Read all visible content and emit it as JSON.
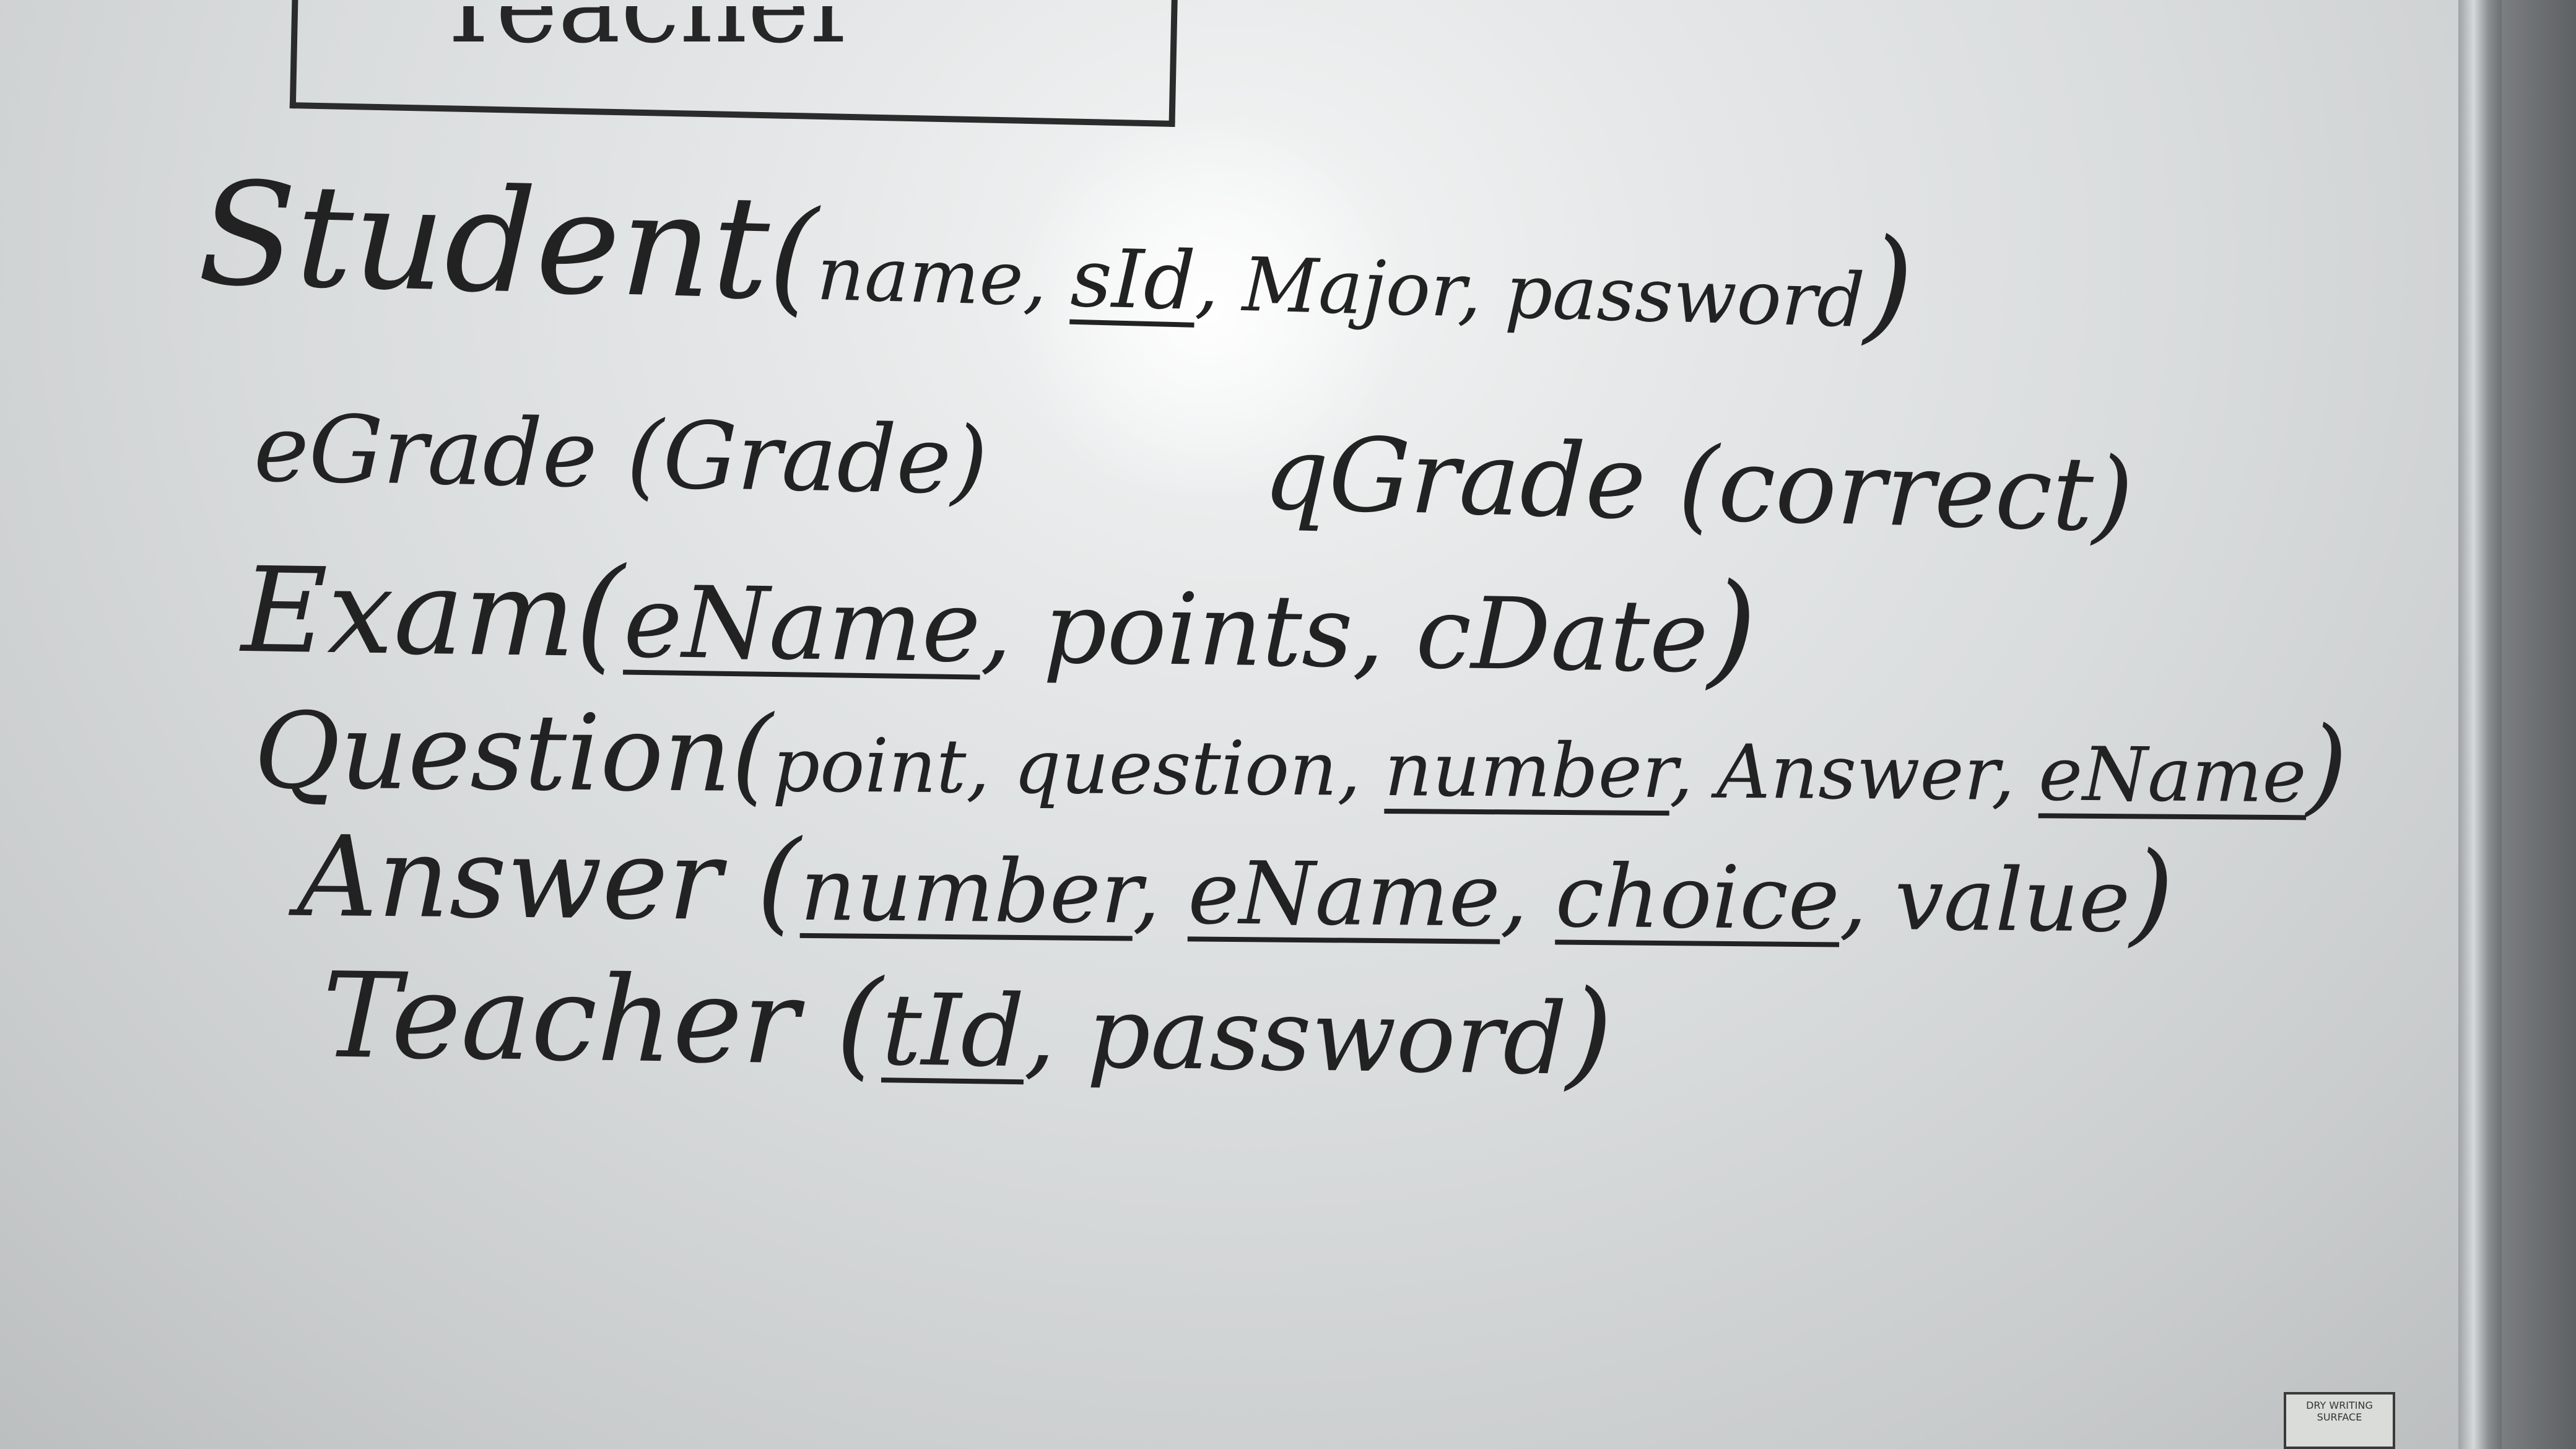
{
  "whiteboard": {
    "top_box_fragment": "Teacher",
    "lines": {
      "student": {
        "name": "Student",
        "open": "(",
        "f1": "name, ",
        "f2": "sId",
        "f3": ", Major, password",
        "close": ")"
      },
      "grades": {
        "egrade": "eGrade (Grade)",
        "qgrade": "qGrade (correct)"
      },
      "exam": {
        "name": "Exam",
        "open": "(",
        "f1": "eName",
        "f2": ", points, cDate",
        "close": ")"
      },
      "question": {
        "name": "Question",
        "open": "(",
        "f1": "point, question, ",
        "f2": "number",
        "f3": ", Answer, ",
        "f4": "eName",
        "close": ")"
      },
      "answer": {
        "name": "Answer",
        "open": " (",
        "f1": "number",
        "f2": ", ",
        "f3": "eName",
        "f4": ", ",
        "f5": "choice",
        "f6": ", value",
        "close": ")"
      },
      "teacher": {
        "name": "Teacher",
        "open": " (",
        "f1": "tId",
        "f2": ", password",
        "close": ")"
      }
    },
    "sticker_text": "DRY WRITING SURFACE"
  }
}
